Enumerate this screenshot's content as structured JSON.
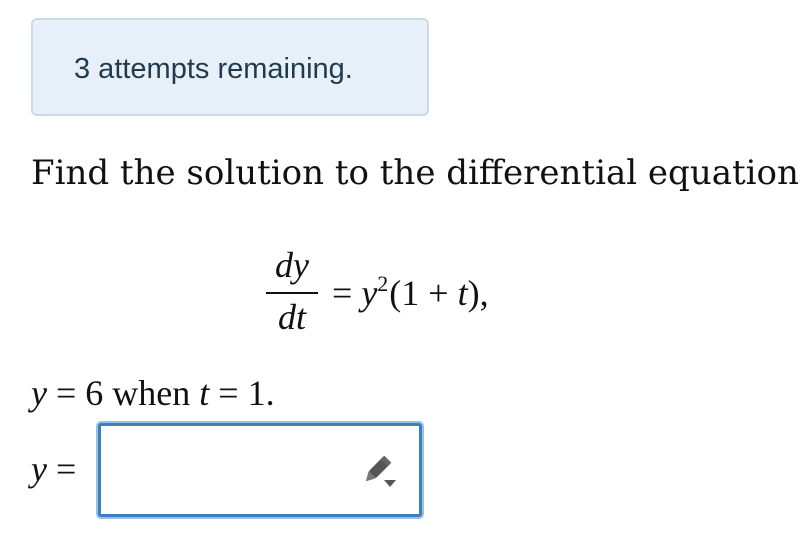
{
  "banner": {
    "attempts_text": "3 attempts remaining."
  },
  "problem": {
    "prompt": "Find the solution to the differential equation",
    "equation": {
      "numerator": "dy",
      "denominator": "dt",
      "equals": "=",
      "rhs_base": "y",
      "rhs_exponent": "2",
      "rhs_rest": "(1 + ",
      "rhs_var": "t",
      "rhs_close": "),"
    },
    "condition": {
      "var_y": "y",
      "eq1": " = 6 when ",
      "var_t": "t",
      "eq2": " = 1."
    }
  },
  "answer": {
    "label_var": "y",
    "label_eq": " =",
    "value": "",
    "editor_icon": "pencil-dropdown-icon"
  },
  "colors": {
    "banner_bg": "#e7eff8",
    "banner_border": "#c9dbe8",
    "input_border": "#3f7fc1"
  }
}
